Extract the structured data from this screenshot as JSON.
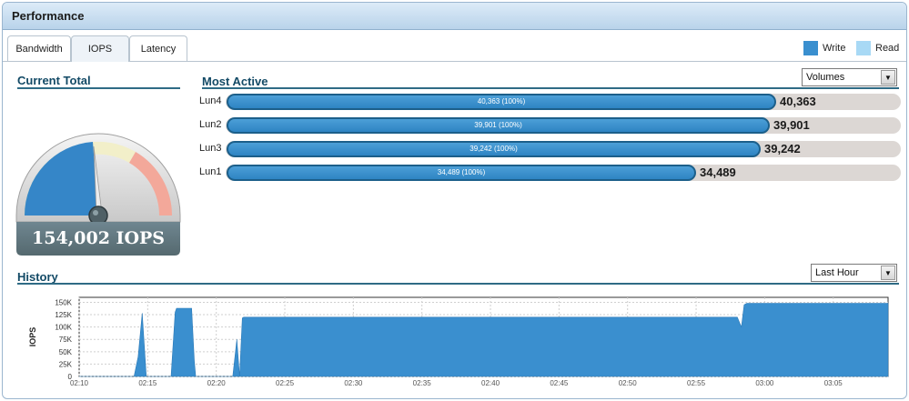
{
  "panel": {
    "title": "Performance"
  },
  "tabs": [
    {
      "label": "Bandwidth"
    },
    {
      "label": "IOPS"
    },
    {
      "label": "Latency"
    }
  ],
  "legend": [
    {
      "label": "Write",
      "color": "#3a8fcf"
    },
    {
      "label": "Read",
      "color": "#a8d9f5"
    }
  ],
  "current_total": {
    "title": "Current Total",
    "value": "154,002 IOPS"
  },
  "most_active": {
    "title": "Most Active",
    "selector": "Volumes",
    "rows": [
      {
        "name": "Lun4",
        "inner_label": "40,363 (100%)",
        "value": "40,363",
        "fraction": 1.0
      },
      {
        "name": "Lun2",
        "inner_label": "39,901 (100%)",
        "value": "39,901",
        "fraction": 0.9886
      },
      {
        "name": "Lun3",
        "inner_label": "39,242 (100%)",
        "value": "39,242",
        "fraction": 0.9722
      },
      {
        "name": "Lun1",
        "inner_label": "34,489 (100%)",
        "value": "34,489",
        "fraction": 0.8545
      }
    ]
  },
  "history": {
    "title": "History",
    "selector": "Last Hour"
  },
  "chart_data": {
    "type": "area",
    "ylabel": "IOPS",
    "xlabel": "",
    "ylim": [
      0,
      160000
    ],
    "y_ticks": [
      "0",
      "25K",
      "50K",
      "75K",
      "100K",
      "125K",
      "150K"
    ],
    "y_tick_values": [
      0,
      25000,
      50000,
      75000,
      100000,
      125000,
      150000
    ],
    "x_ticks": [
      "02:10",
      "02:15",
      "02:20",
      "02:25",
      "02:30",
      "02:35",
      "02:40",
      "02:45",
      "02:50",
      "02:55",
      "03:00",
      "03:05"
    ],
    "grid": true,
    "series": [
      {
        "name": "Write",
        "color": "#3a8fcf",
        "x": [
          "02:10",
          "02:14",
          "02:14.3",
          "02:14.6",
          "02:14.9",
          "02:15.2",
          "02:16.7",
          "02:17",
          "02:17.1",
          "02:18.2",
          "02:18.4",
          "02:18.5",
          "02:21.2",
          "02:21.5",
          "02:21.7",
          "02:21.9",
          "02:22",
          "02:58",
          "02:58.3",
          "02:58.5",
          "02:58.7",
          "03:09"
        ],
        "y": [
          0,
          0,
          40000,
          128000,
          0,
          0,
          0,
          130000,
          138000,
          138000,
          30000,
          0,
          0,
          75000,
          0,
          118000,
          120000,
          120000,
          100000,
          145000,
          148000,
          148000
        ]
      }
    ]
  }
}
